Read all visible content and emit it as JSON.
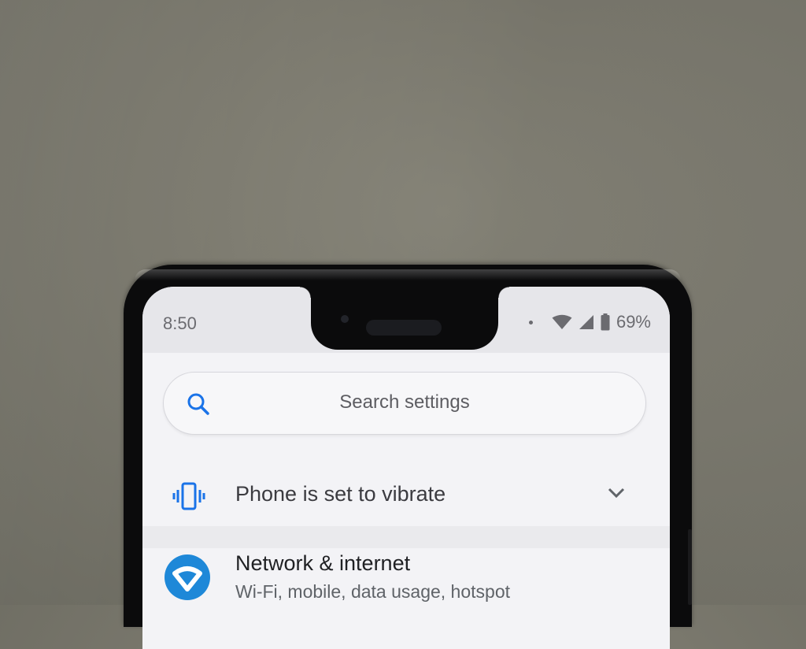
{
  "status_bar": {
    "time": "8:50",
    "battery_percent": "69%",
    "icons": [
      "notification-dot-icon",
      "wifi-icon",
      "cell-signal-icon",
      "battery-icon"
    ]
  },
  "search": {
    "placeholder": "Search settings",
    "icon": "search-icon"
  },
  "vibrate_suggestion": {
    "title": "Phone is set to vibrate",
    "icon": "vibrate-icon",
    "expand_icon": "chevron-down-icon"
  },
  "settings_items": [
    {
      "title": "Network & internet",
      "subtitle": "Wi-Fi, mobile, data usage, hotspot",
      "icon": "wifi-icon"
    }
  ],
  "colors": {
    "accent": "#1e88d8",
    "screen_background": "#f3f3f6",
    "status_bar_background": "#e6e6ea"
  }
}
